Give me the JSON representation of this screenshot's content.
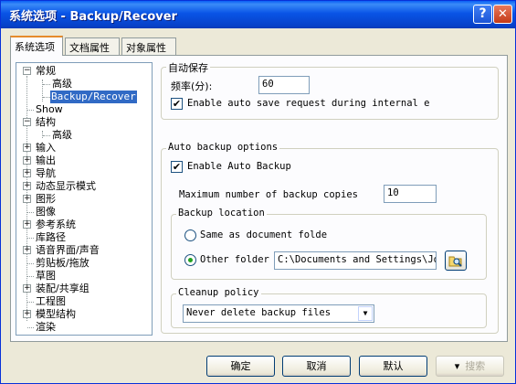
{
  "window": {
    "title": "系统选项 - Backup/Recover",
    "help_label": "?",
    "close_label": "✕"
  },
  "tabs": [
    {
      "label": "系统选项",
      "active": true
    },
    {
      "label": "文档属性",
      "active": false
    },
    {
      "label": "对象属性",
      "active": false
    }
  ],
  "tree": {
    "items": [
      {
        "label": "常规",
        "expander": "−"
      },
      {
        "label": "高级"
      },
      {
        "label": "Backup/Recover",
        "selected": true
      },
      {
        "label": "Show"
      },
      {
        "label": "结构",
        "expander": "−"
      },
      {
        "label": "高级"
      },
      {
        "label": "输入",
        "expander": "+"
      },
      {
        "label": "输出",
        "expander": "+"
      },
      {
        "label": "导航",
        "expander": "+"
      },
      {
        "label": "动态显示模式",
        "expander": "+"
      },
      {
        "label": "图形",
        "expander": "+"
      },
      {
        "label": "图像"
      },
      {
        "label": "参考系统",
        "expander": "+"
      },
      {
        "label": "库路径"
      },
      {
        "label": "语音界面/声音",
        "expander": "+"
      },
      {
        "label": "剪贴板/拖放"
      },
      {
        "label": "草图"
      },
      {
        "label": "装配/共享组",
        "expander": "+"
      },
      {
        "label": "工程图"
      },
      {
        "label": "模型结构",
        "expander": "+"
      },
      {
        "label": "渲染"
      }
    ]
  },
  "autosave": {
    "legend": "自动保存",
    "freq_label": "频率(分):",
    "freq_value": "60",
    "enable_request_label": "Enable auto save request during internal e",
    "enable_request_checked": "✔"
  },
  "autobackup": {
    "legend": "Auto backup options",
    "enable_label": "Enable Auto Backup",
    "enable_checked": "✔",
    "max_copies_label": "Maximum number of backup copies",
    "max_copies_value": "10",
    "location": {
      "legend": "Backup location",
      "same_label": "Same as document folde",
      "other_label": "Other folder",
      "other_selected": true,
      "folder_value": "C:\\Documents and Settings\\Joh",
      "browse_icon": "browse-folder-icon"
    },
    "cleanup": {
      "legend": "Cleanup policy",
      "selected": "Never delete backup files"
    }
  },
  "buttons": {
    "ok": "确定",
    "cancel": "取消",
    "default": "默认",
    "search": "搜索",
    "search_icon": "▾"
  }
}
